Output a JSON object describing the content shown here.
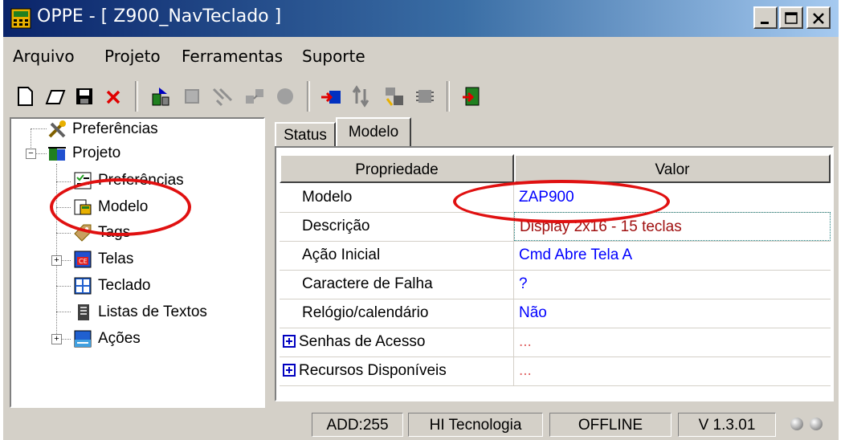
{
  "window": {
    "title": "OPPE - [ Z900_NavTeclado ]",
    "buttons": [
      "minimize",
      "maximize",
      "close"
    ]
  },
  "menu": [
    "Arquivo",
    "Projeto",
    "Ferramentas",
    "Suporte"
  ],
  "toolbar": {
    "icons": [
      "new-icon",
      "open-icon",
      "save-icon",
      "delete-icon",
      "send-icon",
      "stop-icon",
      "connect-icon",
      "network-icon",
      "record-icon",
      "import-icon",
      "transfer-icon",
      "config-icon",
      "chip-icon",
      "exit-icon"
    ]
  },
  "tree": {
    "items": [
      {
        "label": "Preferências",
        "icon": "tools-icon"
      },
      {
        "label": "Projeto",
        "icon": "project-icon"
      },
      {
        "label": "Preferências",
        "icon": "checklist-icon"
      },
      {
        "label": "Modelo",
        "icon": "model-icon"
      },
      {
        "label": "Tags",
        "icon": "tags-icon"
      },
      {
        "label": "Telas",
        "icon": "screens-icon"
      },
      {
        "label": "Teclado",
        "icon": "keyboard-icon"
      },
      {
        "label": "Listas de Textos",
        "icon": "text-list-icon"
      },
      {
        "label": "Ações",
        "icon": "actions-icon"
      }
    ]
  },
  "tabs": [
    "Status",
    "Modelo"
  ],
  "active_tab": "Modelo",
  "grid": {
    "headers": [
      "Propriedade",
      "Valor"
    ],
    "rows": [
      {
        "prop": "Modelo",
        "value": "ZAP900"
      },
      {
        "prop": "Descrição",
        "value": "Display 2x16 - 15 teclas"
      },
      {
        "prop": "Ação Inicial",
        "value": "Cmd Abre Tela A"
      },
      {
        "prop": "Caractere de Falha",
        "value": "?"
      },
      {
        "prop": "Relógio/calendário",
        "value": "Não"
      },
      {
        "prop": "Senhas de Acesso",
        "value": "..."
      },
      {
        "prop": "Recursos Disponíveis",
        "value": "..."
      }
    ]
  },
  "status": {
    "address": "ADD:255",
    "company": "HI Tecnologia",
    "connection": "OFFLINE",
    "version": "V 1.3.01"
  },
  "colors": {
    "title_bar": "#0a246a",
    "value_text": "#0000ff",
    "description_text": "#a01010",
    "annotation": "#e01010",
    "chrome": "#d4d0c8"
  }
}
